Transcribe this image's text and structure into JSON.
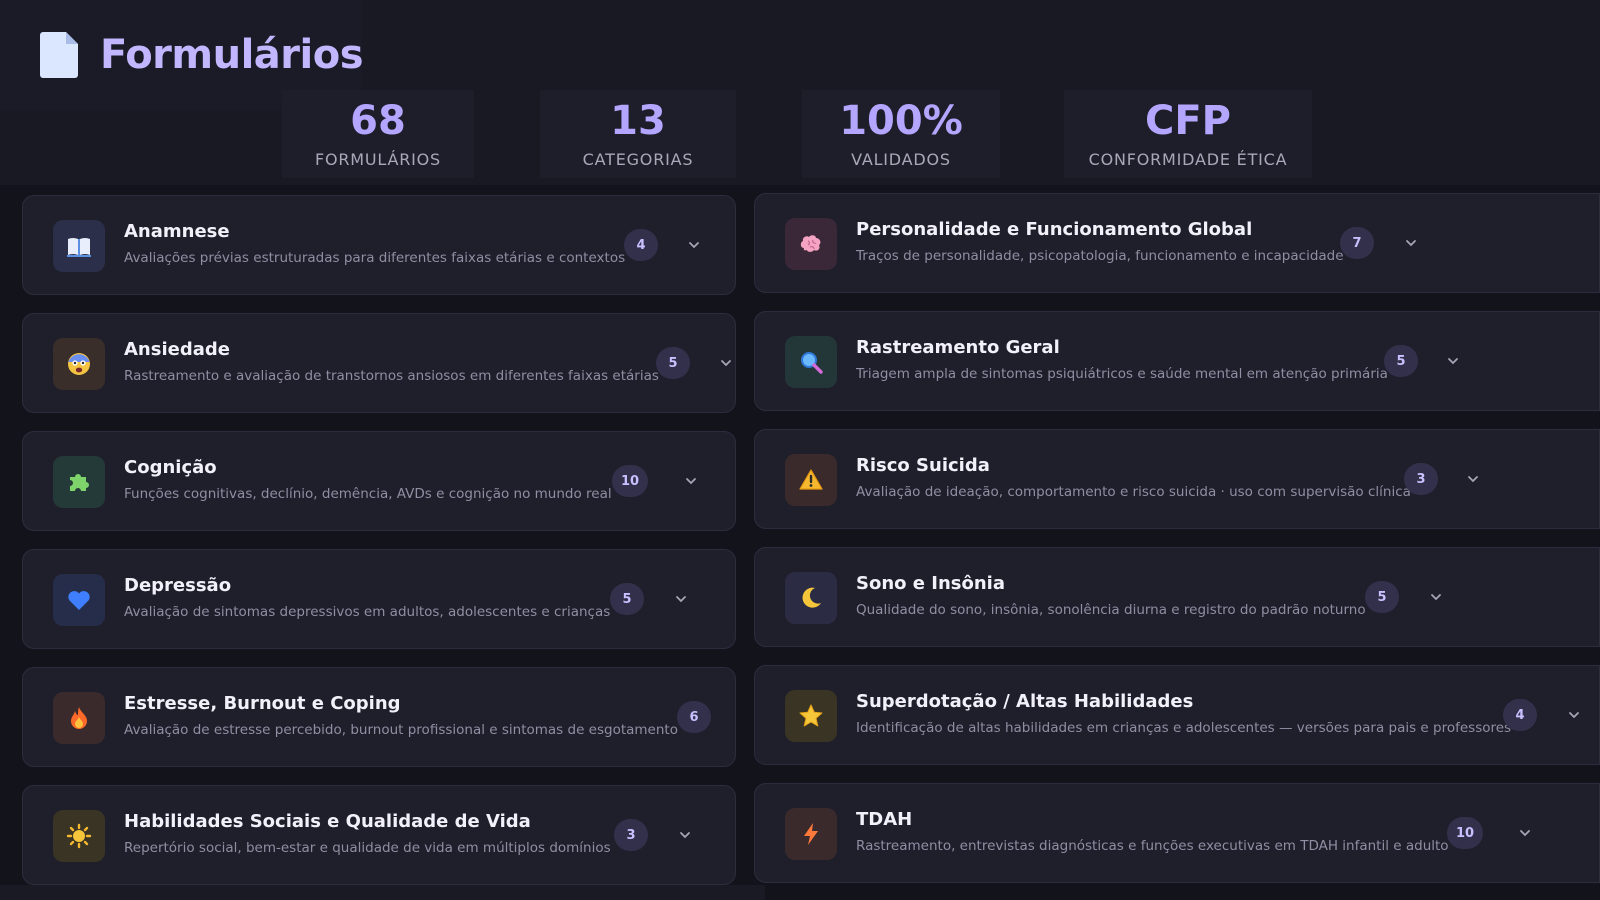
{
  "header": {
    "title": "Formulários"
  },
  "stats": [
    {
      "value": "68",
      "label": "FORMULÁRIOS"
    },
    {
      "value": "13",
      "label": "CATEGORIAS"
    },
    {
      "value": "100%",
      "label": "VALIDADOS"
    },
    {
      "value": "CFP",
      "label": "CONFORMIDADE ÉTICA"
    }
  ],
  "categories": [
    {
      "name": "Anamnese",
      "description": "Avaliações prévias estruturadas para diferentes faixas etárias e contextos",
      "count": "4",
      "icon": "book-icon"
    },
    {
      "name": "Ansiedade",
      "description": "Rastreamento e avaliação de transtornos ansiosos em diferentes faixas etárias",
      "count": "5",
      "icon": "anxious-face-icon"
    },
    {
      "name": "Cognição",
      "description": "Funções cognitivas, declínio, demência, AVDs e cognição no mundo real",
      "count": "10",
      "icon": "puzzle-icon"
    },
    {
      "name": "Depressão",
      "description": "Avaliação de sintomas depressivos em adultos, adolescentes e crianças",
      "count": "5",
      "icon": "blue-heart-icon"
    },
    {
      "name": "Estresse, Burnout e Coping",
      "description": "Avaliação de estresse percebido, burnout profissional e sintomas de esgotamento",
      "count": "6",
      "icon": "fire-icon"
    },
    {
      "name": "Habilidades Sociais e Qualidade de Vida",
      "description": "Repertório social, bem-estar e qualidade de vida em múltiplos domínios",
      "count": "3",
      "icon": "sun-icon"
    },
    {
      "name": "Personalidade e Funcionamento Global",
      "description": "Traços de personalidade, psicopatologia, funcionamento e incapacidade",
      "count": "7",
      "icon": "brain-icon"
    },
    {
      "name": "Rastreamento Geral",
      "description": "Triagem ampla de sintomas psiquiátricos e saúde mental em atenção primária",
      "count": "5",
      "icon": "magnifier-icon"
    },
    {
      "name": "Risco Suicida",
      "description": "Avaliação de ideação, comportamento e risco suicida · uso com supervisão clínica",
      "count": "3",
      "icon": "warning-icon"
    },
    {
      "name": "Sono e Insônia",
      "description": "Qualidade do sono, insônia, sonolência diurna e registro do padrão noturno",
      "count": "5",
      "icon": "moon-icon"
    },
    {
      "name": "Superdotação / Altas Habilidades",
      "description": "Identificação de altas habilidades em crianças e adolescentes — versões para pais e professores",
      "count": "4",
      "icon": "star-icon"
    },
    {
      "name": "TDAH",
      "description": "Rastreamento, entrevistas diagnósticas e funções executivas em TDAH infantil e adulto",
      "count": "10",
      "icon": "lightning-icon"
    }
  ],
  "colors": {
    "accent": "#b4a6ff",
    "title": "#c2b7ff",
    "card_bg": "#1f1f2c",
    "page_bg": "#13131c",
    "badge_bg": "#33304b"
  }
}
